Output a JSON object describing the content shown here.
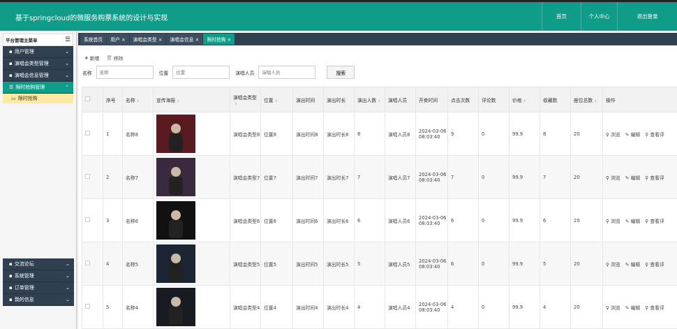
{
  "header": {
    "title": "基于springcloud的微服务购票系统的设计与实现",
    "nav": [
      "首页",
      "个人中心",
      "退出登录"
    ]
  },
  "sidebar": {
    "head": "平台管理主菜单",
    "items": [
      "用户管理",
      "演唱会类型管理",
      "演唱会信息管理",
      "限时抢购管理"
    ],
    "sub": "限时抢购",
    "bottom": [
      "交流论坛",
      "系统管理",
      "订单管理",
      "我的信息"
    ]
  },
  "tabs": [
    "系统首页",
    "用户 ×",
    "演唱会类型 ×",
    "演唱会信息 ×",
    "限时抢购 ×"
  ],
  "toolbar": {
    "add": "新增",
    "delete": "移除"
  },
  "search": {
    "name_label": "名称",
    "name_placeholder": "名称",
    "position_label": "位置",
    "position_placeholder": "位置",
    "performer_label": "演唱人员",
    "performer_placeholder": "演唱人员",
    "button": "搜索"
  },
  "table": {
    "headers": [
      "序号",
      "名称",
      "宣传海报",
      "演唱会类型",
      "位置",
      "演出时间",
      "演出时长",
      "演出人数",
      "演唱人员",
      "开卖时间",
      "点击次数",
      "评论数",
      "价格",
      "收藏数",
      "座位总数",
      "操作"
    ],
    "ops": [
      "浏览",
      "编辑",
      "查看评"
    ],
    "rows": [
      [
        "1",
        "名称8",
        "",
        "演唱会类型8",
        "位置8",
        "演出时间8",
        "演出时长8",
        "8",
        "演唱人员8",
        "2024-03-06 08:03:40",
        "9",
        "0",
        "99.9",
        "8",
        "20"
      ],
      [
        "2",
        "名称7",
        "",
        "演唱会类型7",
        "位置7",
        "演出时间7",
        "演出时长7",
        "7",
        "演唱人员7",
        "2024-03-06 08:03:40",
        "7",
        "0",
        "99.9",
        "7",
        "20"
      ],
      [
        "3",
        "名称6",
        "",
        "演唱会类型6",
        "位置6",
        "演出时间6",
        "演出时长6",
        "6",
        "演唱人员6",
        "2024-03-06 08:03:40",
        "6",
        "0",
        "99.9",
        "6",
        "20"
      ],
      [
        "4",
        "名称5",
        "",
        "演唱会类型5",
        "位置5",
        "演出时间5",
        "演出时长5",
        "5",
        "演唱人员5",
        "2024-03-06 08:03:40",
        "6",
        "0",
        "99.9",
        "5",
        "20"
      ],
      [
        "5",
        "名称4",
        "",
        "演唱会类型4",
        "位置4",
        "演出时间4",
        "演出时长4",
        "4",
        "演唱人员4",
        "2024-03-06 08:03:40",
        "4",
        "0",
        "99.9",
        "4",
        "20"
      ]
    ]
  }
}
